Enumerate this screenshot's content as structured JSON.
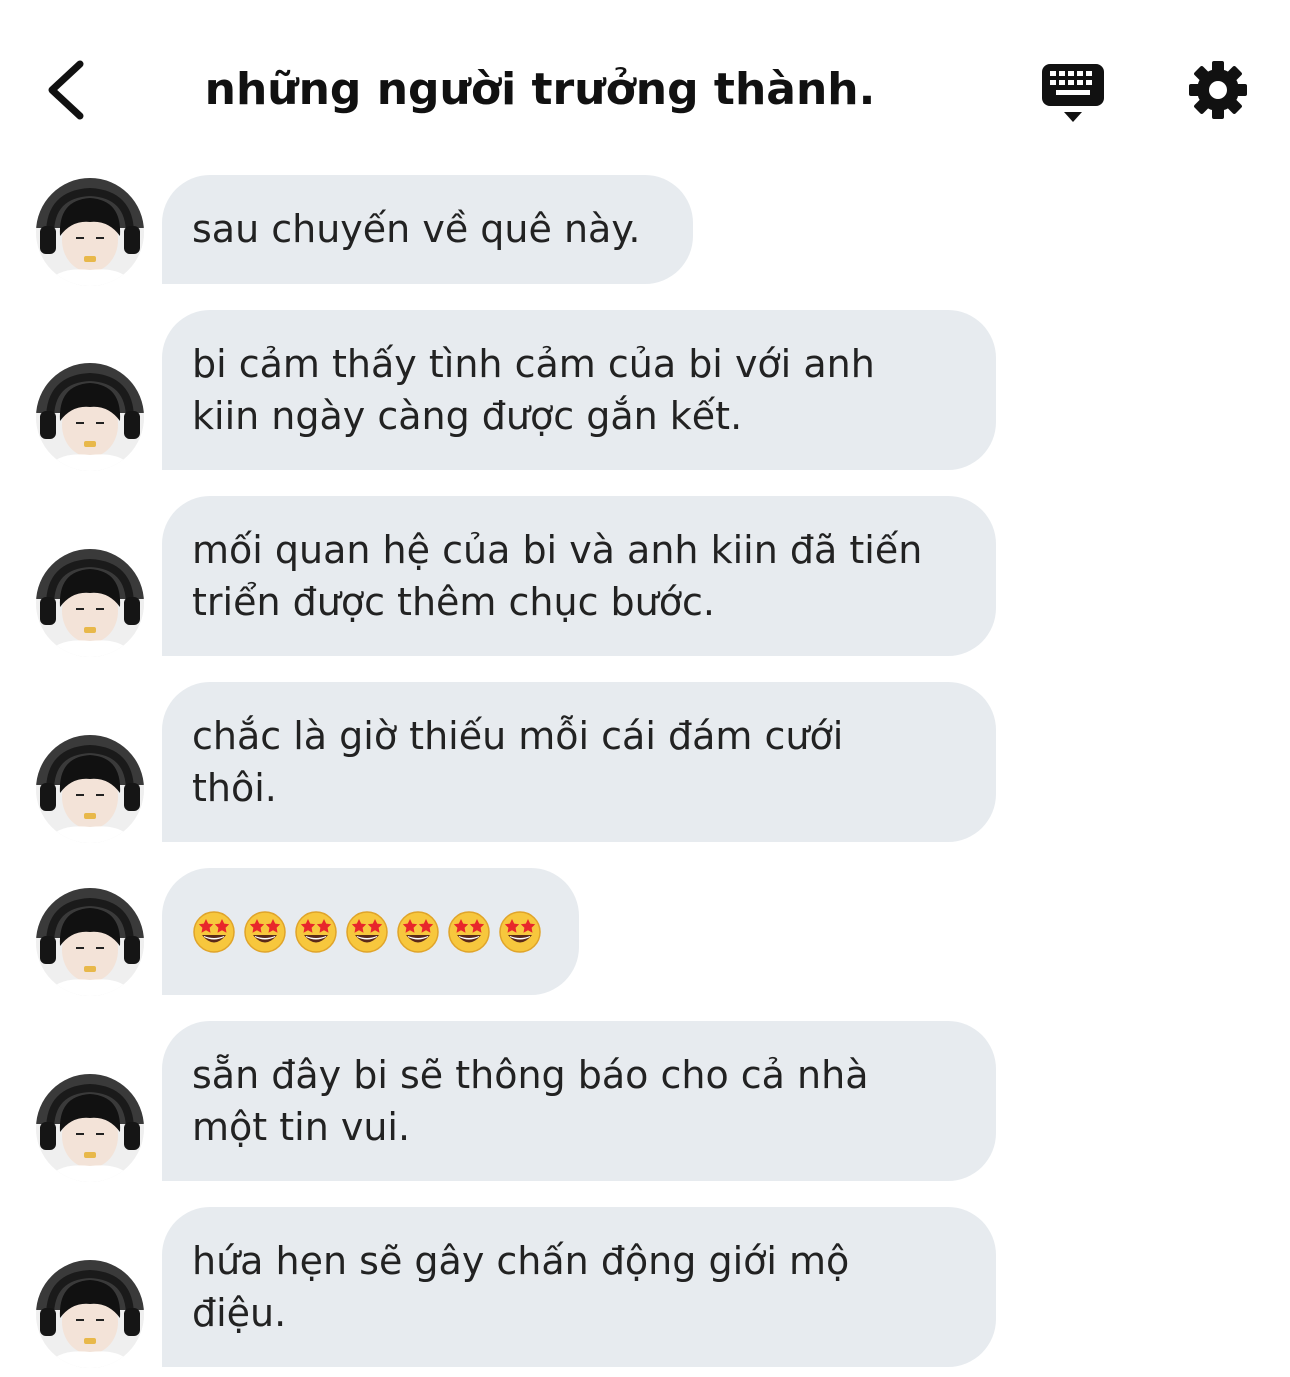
{
  "header": {
    "title": "những người trưởng thành.",
    "back_icon": "chevron-left-icon",
    "keyboard_icon": "keyboard-icon",
    "settings_icon": "gear-icon"
  },
  "colors": {
    "bubble_bg": "#e7ebef",
    "text": "#222222",
    "icon": "#111111"
  },
  "messages": [
    {
      "lines": "sau chuyến về quê này."
    },
    {
      "lines": "bi cảm thấy tình cảm của bi với anh\nkiin ngày càng được gắn kết."
    },
    {
      "lines": "mối quan hệ của bi và anh kiin đã tiến\ntriển được thêm chục bước."
    },
    {
      "lines": "chắc là giờ thiếu mỗi cái đám cưới\nthôi."
    },
    {
      "emoji": "star-struck",
      "emoji_count": 7
    },
    {
      "lines": "sẵn đây bi sẽ thông báo cho cả nhà\nmột tin vui."
    },
    {
      "lines": "hứa hẹn sẽ gây chấn động giới mộ\nđiệu."
    }
  ]
}
